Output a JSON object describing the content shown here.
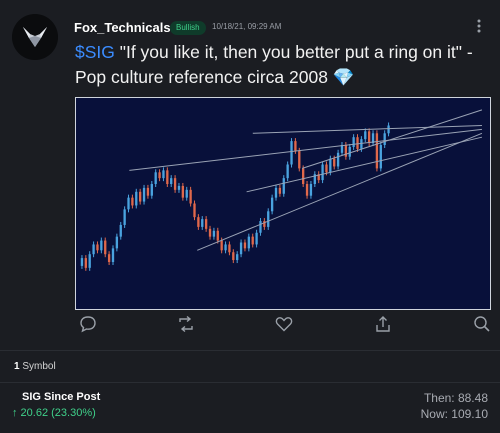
{
  "post": {
    "username": "Fox_Technicals",
    "sentiment": "Bullish",
    "timestamp": "10/18/21, 09:29 AM",
    "cashtag": "$SIG",
    "text": " \"If you like it, then you better put a ring on it\" - Pop culture reference circa 2008 ",
    "emoji": "💎",
    "avatar_icon": "fox-logo",
    "actions": [
      "comment-icon",
      "repost-icon",
      "like-icon",
      "share-icon",
      "search-icon"
    ]
  },
  "symbols": {
    "count": "1",
    "label": "Symbol"
  },
  "ticker": {
    "name": "SIG Since Post",
    "change": "↑ 20.62 (23.30%)",
    "then": "Then: 88.48",
    "now": "Now: 109.10"
  },
  "colors": {
    "background": "#1b1d22",
    "chart_background": "#08103a",
    "bullish_green": "#3fd08a",
    "cashtag_blue": "#3b8cff",
    "candle_up": "#4aa3df",
    "candle_down": "#e0684b"
  },
  "chart_data": {
    "type": "candlestick",
    "title": "",
    "xlabel": "",
    "ylabel": "",
    "ylim": [
      0,
      100
    ],
    "grid": false,
    "candles": [
      {
        "o": 18,
        "c": 22
      },
      {
        "o": 22,
        "c": 17
      },
      {
        "o": 17,
        "c": 24
      },
      {
        "o": 24,
        "c": 29
      },
      {
        "o": 29,
        "c": 26
      },
      {
        "o": 26,
        "c": 31
      },
      {
        "o": 31,
        "c": 24
      },
      {
        "o": 24,
        "c": 20
      },
      {
        "o": 20,
        "c": 27
      },
      {
        "o": 27,
        "c": 33
      },
      {
        "o": 33,
        "c": 39
      },
      {
        "o": 39,
        "c": 47
      },
      {
        "o": 47,
        "c": 53
      },
      {
        "o": 53,
        "c": 49
      },
      {
        "o": 49,
        "c": 56
      },
      {
        "o": 56,
        "c": 51
      },
      {
        "o": 51,
        "c": 58
      },
      {
        "o": 58,
        "c": 54
      },
      {
        "o": 54,
        "c": 60
      },
      {
        "o": 60,
        "c": 66
      },
      {
        "o": 66,
        "c": 63
      },
      {
        "o": 63,
        "c": 67
      },
      {
        "o": 67,
        "c": 60
      },
      {
        "o": 60,
        "c": 63
      },
      {
        "o": 63,
        "c": 57
      },
      {
        "o": 57,
        "c": 59
      },
      {
        "o": 59,
        "c": 53
      },
      {
        "o": 53,
        "c": 57
      },
      {
        "o": 57,
        "c": 50
      },
      {
        "o": 50,
        "c": 43
      },
      {
        "o": 43,
        "c": 38
      },
      {
        "o": 38,
        "c": 42
      },
      {
        "o": 42,
        "c": 37
      },
      {
        "o": 37,
        "c": 33
      },
      {
        "o": 33,
        "c": 36
      },
      {
        "o": 36,
        "c": 31
      },
      {
        "o": 31,
        "c": 26
      },
      {
        "o": 26,
        "c": 29
      },
      {
        "o": 29,
        "c": 25
      },
      {
        "o": 25,
        "c": 21
      },
      {
        "o": 21,
        "c": 24
      },
      {
        "o": 24,
        "c": 30
      },
      {
        "o": 30,
        "c": 27
      },
      {
        "o": 27,
        "c": 33
      },
      {
        "o": 33,
        "c": 29
      },
      {
        "o": 29,
        "c": 35
      },
      {
        "o": 35,
        "c": 41
      },
      {
        "o": 41,
        "c": 38
      },
      {
        "o": 38,
        "c": 46
      },
      {
        "o": 46,
        "c": 53
      },
      {
        "o": 53,
        "c": 58
      },
      {
        "o": 58,
        "c": 55
      },
      {
        "o": 55,
        "c": 63
      },
      {
        "o": 63,
        "c": 70
      },
      {
        "o": 70,
        "c": 82
      },
      {
        "o": 82,
        "c": 77
      },
      {
        "o": 77,
        "c": 68
      },
      {
        "o": 68,
        "c": 60
      },
      {
        "o": 60,
        "c": 54
      },
      {
        "o": 54,
        "c": 60
      },
      {
        "o": 60,
        "c": 65
      },
      {
        "o": 65,
        "c": 62
      },
      {
        "o": 62,
        "c": 70
      },
      {
        "o": 70,
        "c": 66
      },
      {
        "o": 66,
        "c": 73
      },
      {
        "o": 73,
        "c": 69
      },
      {
        "o": 69,
        "c": 76
      },
      {
        "o": 76,
        "c": 80
      },
      {
        "o": 80,
        "c": 74
      },
      {
        "o": 74,
        "c": 79
      },
      {
        "o": 79,
        "c": 84
      },
      {
        "o": 84,
        "c": 78
      },
      {
        "o": 78,
        "c": 83
      },
      {
        "o": 83,
        "c": 87
      },
      {
        "o": 87,
        "c": 81
      },
      {
        "o": 81,
        "c": 86
      },
      {
        "o": 86,
        "c": 68
      },
      {
        "o": 68,
        "c": 80
      },
      {
        "o": 80,
        "c": 86
      },
      {
        "o": 86,
        "c": 90
      }
    ],
    "trendlines": [
      {
        "from": [
          16,
          67
        ],
        "to": [
          99,
          88
        ]
      },
      {
        "from": [
          56,
          86
        ],
        "to": [
          99,
          90
        ]
      },
      {
        "from": [
          38,
          26
        ],
        "to": [
          99,
          86
        ]
      },
      {
        "from": [
          54,
          56
        ],
        "to": [
          99,
          84
        ]
      },
      {
        "from": [
          72,
          68
        ],
        "to": [
          99,
          98
        ]
      }
    ]
  }
}
